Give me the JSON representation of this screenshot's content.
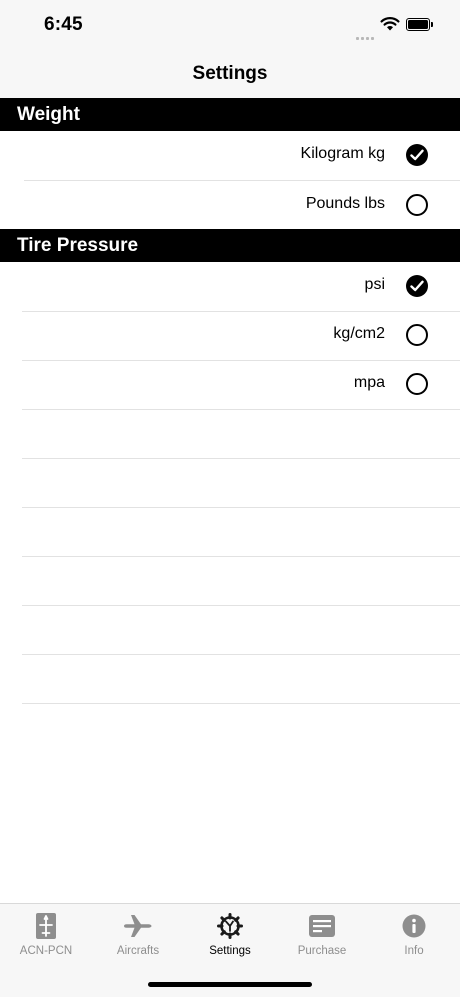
{
  "status_bar": {
    "time": "6:45"
  },
  "nav": {
    "title": "Settings"
  },
  "sections": [
    {
      "title": "Weight",
      "options": [
        {
          "label": "Kilogram kg",
          "selected": true
        },
        {
          "label": "Pounds lbs",
          "selected": false
        }
      ]
    },
    {
      "title": "Tire Pressure",
      "options": [
        {
          "label": "psi",
          "selected": true
        },
        {
          "label": "kg/cm2",
          "selected": false
        },
        {
          "label": "mpa",
          "selected": false
        }
      ]
    }
  ],
  "tabs": [
    {
      "label": "ACN-PCN",
      "icon": "acn-pcn-icon",
      "active": false
    },
    {
      "label": "Aircrafts",
      "icon": "airplane-icon",
      "active": false
    },
    {
      "label": "Settings",
      "icon": "gear-icon",
      "active": true
    },
    {
      "label": "Purchase",
      "icon": "receipt-icon",
      "active": false
    },
    {
      "label": "Info",
      "icon": "info-icon",
      "active": false
    }
  ],
  "colors": {
    "section_header_bg": "#000000",
    "bar_bg": "#f7f7f7",
    "inactive_tab": "#8e8e8e",
    "active_tab": "#000000"
  }
}
